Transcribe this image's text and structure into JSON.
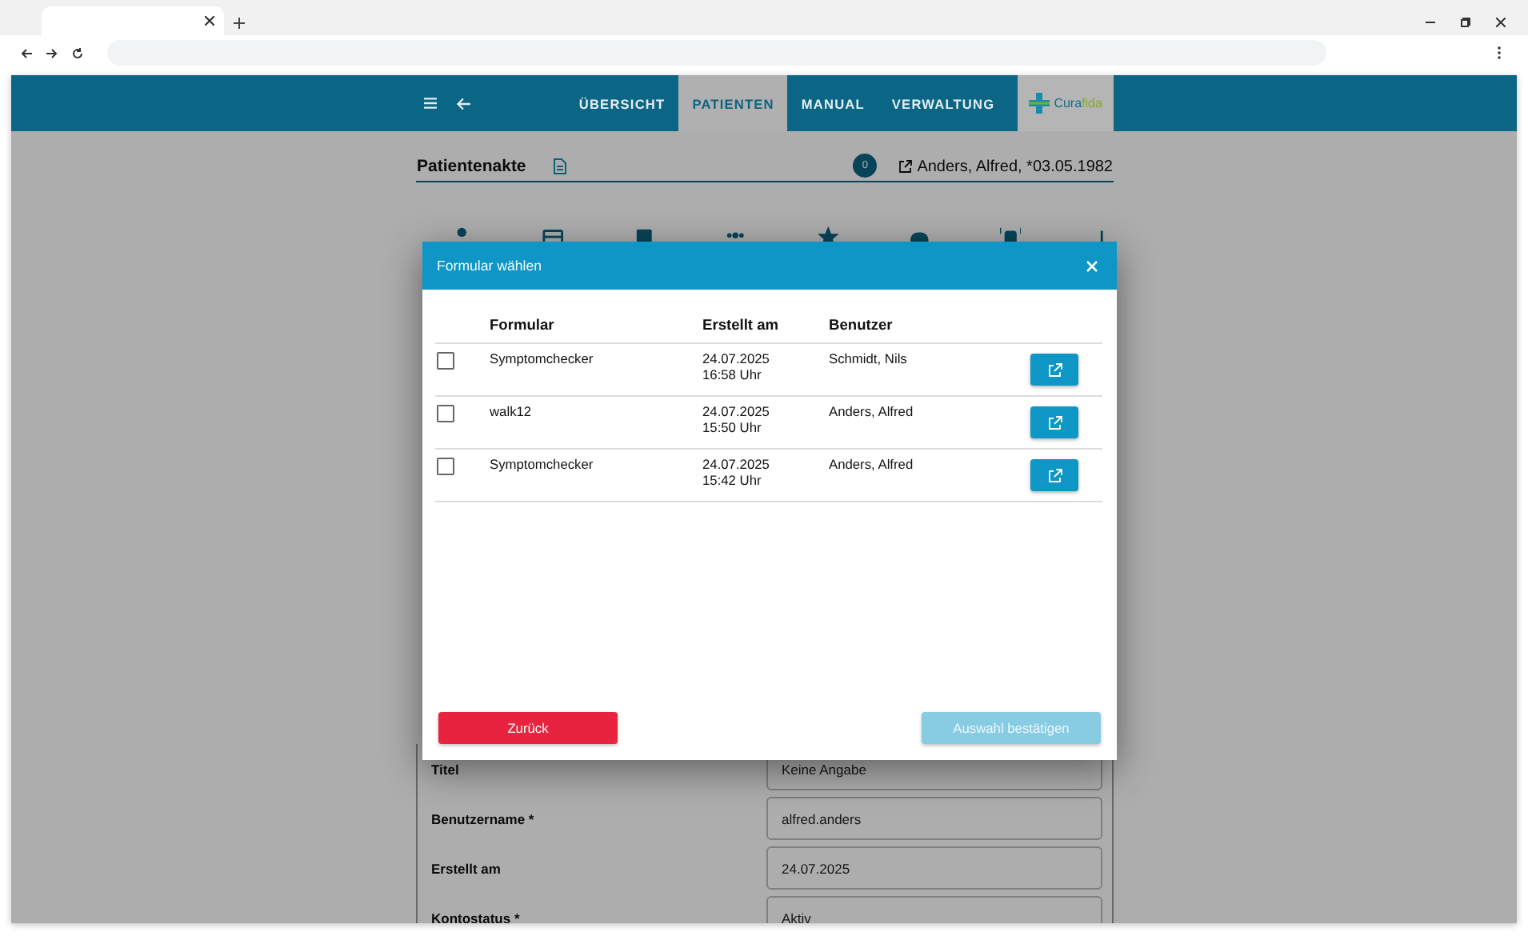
{
  "header": {
    "nav": [
      {
        "label": "ÜBERSICHT",
        "selected": false
      },
      {
        "label": "PATIENTEN",
        "selected": true
      },
      {
        "label": "MANUAL",
        "selected": false
      },
      {
        "label": "VERWALTUNG",
        "selected": false
      }
    ],
    "logo_parts": [
      "Cura",
      "fida"
    ]
  },
  "patient_record": {
    "title": "Patientenakte",
    "message_count": "0",
    "patient": "Anders, Alfred, *03.05.1982"
  },
  "form_fields": [
    {
      "label": "Titel",
      "value": "Keine Angabe"
    },
    {
      "label": "Benutzername *",
      "value": "alfred.anders"
    },
    {
      "label": "Erstellt am",
      "value": "24.07.2025"
    },
    {
      "label": "Kontostatus *",
      "value": "Aktiv"
    }
  ],
  "dialog": {
    "title": "Formular wählen",
    "columns": [
      "Formular",
      "Erstellt am",
      "Benutzer"
    ],
    "rows": [
      {
        "checked": false,
        "form": "Symptomchecker",
        "created": "24.07.2025\n16:58 Uhr",
        "user": "Schmidt, Nils"
      },
      {
        "checked": false,
        "form": "walk12",
        "created": "24.07.2025\n15:50 Uhr",
        "user": "Anders, Alfred"
      },
      {
        "checked": false,
        "form": "Symptomchecker",
        "created": "24.07.2025\n15:42 Uhr",
        "user": "Anders, Alfred"
      }
    ],
    "buttons": [
      {
        "label": "Zurück",
        "kind": "cancel",
        "disabled": false
      },
      {
        "label": "Auswahl bestätigen",
        "kind": "confirm",
        "disabled": true
      }
    ]
  }
}
